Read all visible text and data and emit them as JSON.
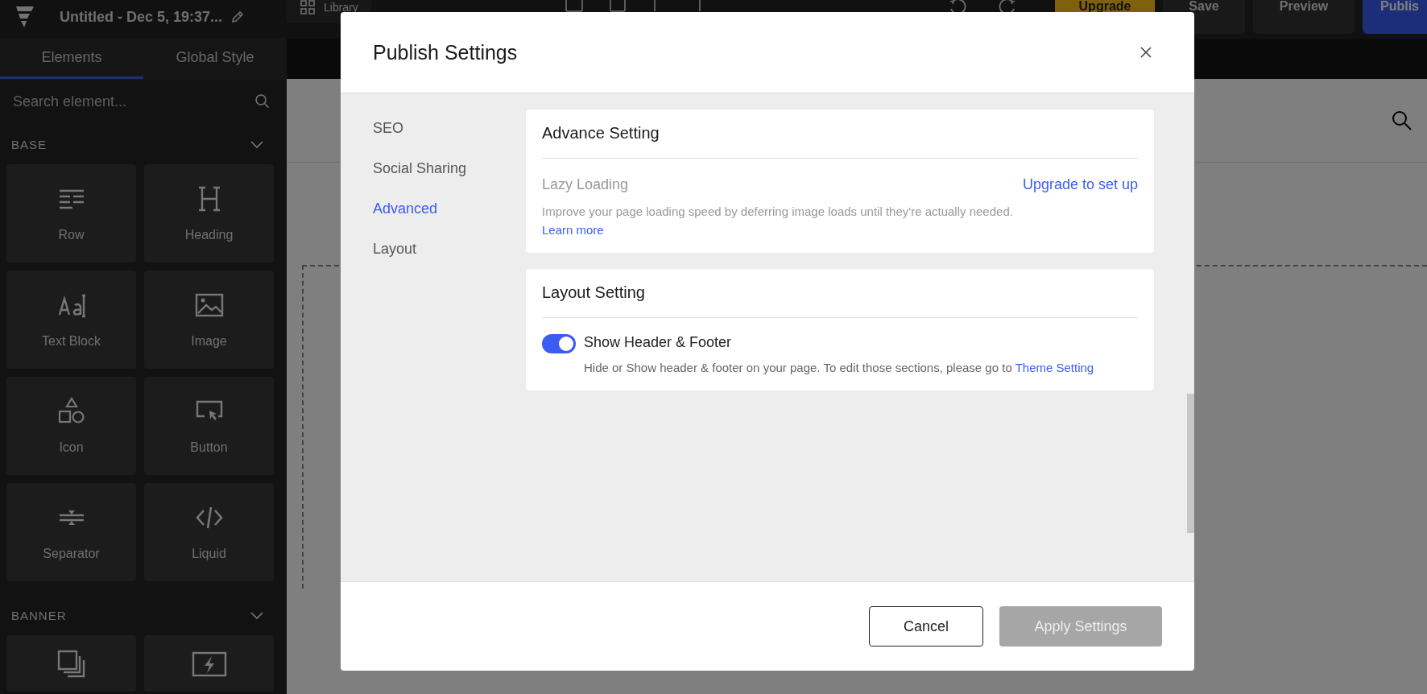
{
  "app_bar": {
    "document_title": "Untitled - Dec 5, 19:37...",
    "library_button": "Library",
    "buttons": [
      {
        "label": "Upgrade",
        "kind": "upgrade"
      },
      {
        "label": "Save",
        "kind": "plain"
      },
      {
        "label": "Preview",
        "kind": "plain"
      },
      {
        "label": "Publis",
        "kind": "primary"
      }
    ]
  },
  "sidebar": {
    "tabs": [
      {
        "label": "Elements",
        "selected": true
      },
      {
        "label": "Global Style",
        "selected": false
      }
    ],
    "search": {
      "placeholder": "Search element..."
    },
    "sections": [
      {
        "title": "BASE",
        "expanded": true,
        "items": [
          "Row",
          "Heading",
          "Text Block",
          "Image",
          "Icon",
          "Button",
          "Separator",
          "Liquid"
        ]
      },
      {
        "title": "BANNER",
        "expanded": true
      }
    ]
  },
  "dialog": {
    "title": "Publish Settings",
    "nav": [
      {
        "label": "SEO",
        "selected": false
      },
      {
        "label": "Social Sharing",
        "selected": false
      },
      {
        "label": "Advanced",
        "selected": true
      },
      {
        "label": "Layout",
        "selected": false
      }
    ],
    "sections": [
      {
        "title": "Advance Setting",
        "kind": "upgrade",
        "label": "Lazy Loading",
        "disabled": true,
        "action": "Upgrade to set up",
        "description": "Improve your page loading speed by deferring image loads until they're actually needed.",
        "link": "Learn more"
      },
      {
        "title": "Layout Setting",
        "kind": "toggle",
        "label": "Show Header & Footer",
        "on": true,
        "description": "Hide or Show header & footer on your page. To edit those sections, please go to",
        "link": "Theme Setting"
      }
    ],
    "buttons": [
      {
        "label": "Cancel",
        "kind": "secondary",
        "disabled": false
      },
      {
        "label": "Apply Settings",
        "kind": "primary",
        "disabled": true
      }
    ]
  }
}
